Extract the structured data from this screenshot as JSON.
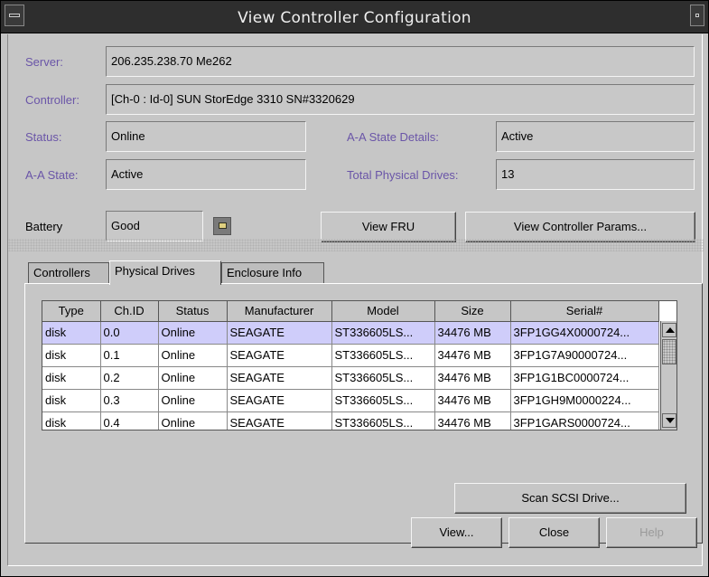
{
  "window": {
    "title": "View Controller Configuration"
  },
  "server": {
    "label": "Server:",
    "value": "206.235.238.70 Me262"
  },
  "controller": {
    "label": "Controller:",
    "value": "[Ch-0 : Id-0] SUN StorEdge 3310 SN#3320629"
  },
  "status": {
    "label": "Status:",
    "value": "Online"
  },
  "aa_state_details": {
    "label": "A-A State Details:",
    "value": "Active"
  },
  "aa_state": {
    "label": "A-A State:",
    "value": "Active"
  },
  "total_drives": {
    "label": "Total Physical Drives:",
    "value": "13"
  },
  "battery": {
    "label": "Battery",
    "value": "Good",
    "icon": "battery-icon"
  },
  "buttons": {
    "view_fru": "View FRU",
    "view_params": "View Controller Params...",
    "scan_scsi": "Scan SCSI Drive...",
    "view": "View...",
    "close": "Close",
    "help": "Help"
  },
  "tabs": [
    "Controllers",
    "Physical Drives",
    "Enclosure Info"
  ],
  "active_tab": "Physical Drives",
  "table": {
    "columns": [
      "Type",
      "Ch.ID",
      "Status",
      "Manufacturer",
      "Model",
      "Size",
      "Serial#"
    ],
    "rows": [
      [
        "disk",
        "0.0",
        "Online",
        "SEAGATE",
        "ST336605LS...",
        "34476 MB",
        "3FP1GG4X0000724..."
      ],
      [
        "disk",
        "0.1",
        "Online",
        "SEAGATE",
        "ST336605LS...",
        "34476 MB",
        "3FP1G7A90000724..."
      ],
      [
        "disk",
        "0.2",
        "Online",
        "SEAGATE",
        "ST336605LS...",
        "34476 MB",
        "3FP1G1BC0000724..."
      ],
      [
        "disk",
        "0.3",
        "Online",
        "SEAGATE",
        "ST336605LS...",
        "34476 MB",
        "3FP1GH9M0000224..."
      ],
      [
        "disk",
        "0.4",
        "Online",
        "SEAGATE",
        "ST336605LS...",
        "34476 MB",
        "3FP1GARS0000724..."
      ]
    ],
    "selected_row": 0
  },
  "colors": {
    "label_accent": "#6a55a8",
    "selected_row": "#cfcdfa",
    "titlebar": "#2e2e2e"
  }
}
